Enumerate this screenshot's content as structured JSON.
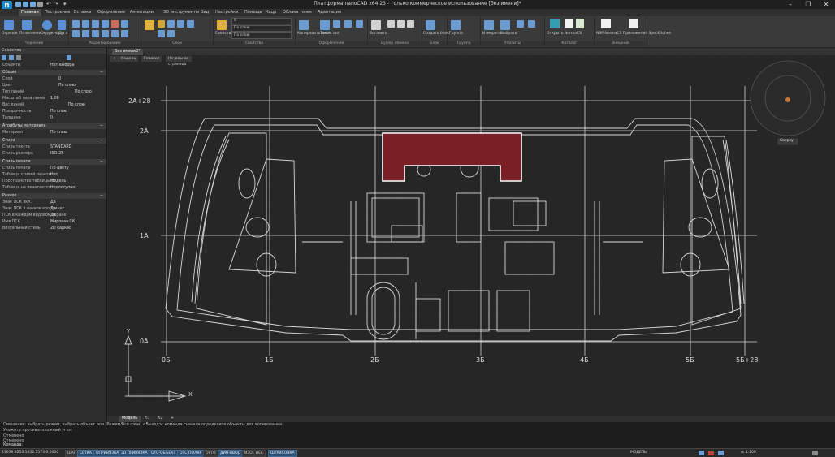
{
  "window": {
    "title": "Платформа nanoCAD x64 23 - только коммерческое использование [без имени]*",
    "controls": {
      "minimize": "–",
      "maximize": "❐",
      "close": "✕"
    }
  },
  "menu": {
    "items": [
      "Главная",
      "Построение",
      "Вставка",
      "Оформление",
      "Аннотации",
      "3D инструменты",
      "Вид",
      "Настройки",
      "Помощь",
      "Кадр",
      "Облака точек",
      "Адаптация"
    ],
    "active_index": 0
  },
  "ribbon": {
    "groups": [
      {
        "label": "Черчение"
      },
      {
        "label": "Редактирование"
      },
      {
        "label": "Слои"
      },
      {
        "label": "Свойства"
      },
      {
        "label": "Оформление"
      },
      {
        "label": "Буфер обмена"
      },
      {
        "label": "Блок"
      },
      {
        "label": "Группа"
      },
      {
        "label": "Утилиты"
      },
      {
        "label": "Каталог"
      },
      {
        "label": "Внешний"
      }
    ],
    "tools": {
      "line": "Отрезок",
      "polyline": "Полилиния",
      "circle": "Окружность",
      "arc": "Дуга",
      "layer_props": "Свойства",
      "copy_props": "Копировать свойства",
      "text": "Текст",
      "insert": "Вставить",
      "block_create": "Создать блок",
      "group": "Группа",
      "measure": "Измерить",
      "select": "Выбрать",
      "open_normacs": "Открыть NormaCS",
      "open_spec": "Открыть SpecKitchen",
      "nanocad_spec": "NSP NormaCS Приложения SpecKitchen"
    },
    "combos": {
      "layer": "0",
      "color": "По слою",
      "linetype": "По слою",
      "lineweight": "По слою"
    }
  },
  "properties": {
    "panel_title": "Свойства",
    "selection": {
      "label": "Объекты",
      "value": "Нет выбора"
    },
    "sections": [
      {
        "title": "Общие",
        "rows": [
          {
            "key": "Слой",
            "value": "0"
          },
          {
            "key": "Цвет",
            "value": "По слою"
          },
          {
            "key": "Тип линий",
            "value": "По слою"
          },
          {
            "key": "Масштаб типа линий",
            "value": "1.00"
          },
          {
            "key": "Вес линий",
            "value": "По слою"
          },
          {
            "key": "Прозрачность",
            "value": "По слою"
          },
          {
            "key": "Толщина",
            "value": "0"
          }
        ]
      },
      {
        "title": "Атрибуты материала",
        "rows": [
          {
            "key": "Материал",
            "value": "По слою"
          }
        ]
      },
      {
        "title": "Стили",
        "rows": [
          {
            "key": "Стиль текста",
            "value": "STANDARD"
          },
          {
            "key": "Стиль размера",
            "value": "ISO-25"
          }
        ]
      },
      {
        "title": "Стиль печати",
        "rows": [
          {
            "key": "Стиль печати",
            "value": "По цвету"
          },
          {
            "key": "Таблица стилей печати",
            "value": "Нет"
          },
          {
            "key": "Пространство таблицы ст.",
            "value": "Модель"
          },
          {
            "key": "Таблица не печатается",
            "value": "Недоступно"
          }
        ]
      },
      {
        "title": "Разное",
        "rows": [
          {
            "key": "Знак ПСК вкл.",
            "value": "Да"
          },
          {
            "key": "Знак ПСК в начале координат",
            "value": "Да"
          },
          {
            "key": "ПСК в каждом видовом экране",
            "value": "Да"
          },
          {
            "key": "Имя ПСК",
            "value": "Мировая СК"
          },
          {
            "key": "Визуальный стиль",
            "value": "2D каркас"
          }
        ]
      }
    ]
  },
  "doc_tabs": {
    "items": [
      "Без имени0*"
    ],
    "sub_items": [
      "+",
      "Модель",
      "Главная",
      "Начальная страница"
    ]
  },
  "drawing": {
    "grid_labels_y": [
      {
        "text": "2A+28"
      },
      {
        "text": "2A"
      },
      {
        "text": "1A"
      },
      {
        "text": "0A"
      }
    ],
    "grid_labels_x": [
      {
        "text": "0Б"
      },
      {
        "text": "1Б"
      },
      {
        "text": "2Б"
      },
      {
        "text": "3Б"
      },
      {
        "text": "4Б"
      },
      {
        "text": "5Б"
      },
      {
        "text": "5Б+28"
      }
    ],
    "axis_x": "X",
    "axis_y": "Y",
    "viewcube_label": "Сверху",
    "highlight_color": "#7a1f26",
    "line_color": "#d8d8d8"
  },
  "layout_tabs": {
    "items": [
      "Модель",
      "Л1",
      "Л2",
      "+"
    ],
    "active_index": 0
  },
  "command_line": {
    "history": [
      "Смещение: выбрать режим, выбрать объект или [Режим/Все слои] <Выход>: команда сначала определите объекты для копирования",
      "Укажите противоположный угол:",
      "Отменено",
      "Отменено"
    ],
    "prompt": "Команда:"
  },
  "statusbar": {
    "coords": "21659.3253,1432.5573,0.0000",
    "toggles": [
      {
        "label": "ШАГ",
        "on": false
      },
      {
        "label": "СЕТКА",
        "on": true
      },
      {
        "label": "ОПРИВЯЗКА",
        "on": true
      },
      {
        "label": "3D ПРИВЯЗКА",
        "on": true
      },
      {
        "label": "ОТС-ОБЪЕКТ",
        "on": true
      },
      {
        "label": "ОТС-ПОЛЯР",
        "on": true
      },
      {
        "label": "ОРТО",
        "on": false
      },
      {
        "label": "ДИН-ВВОД",
        "on": true
      },
      {
        "label": "ИЗО",
        "on": false
      },
      {
        "label": "ВЕС",
        "on": false
      },
      {
        "label": "ШТРИХОВКА",
        "on": true
      }
    ],
    "model": "МОДЕЛЬ",
    "scale": "m 1:100"
  }
}
